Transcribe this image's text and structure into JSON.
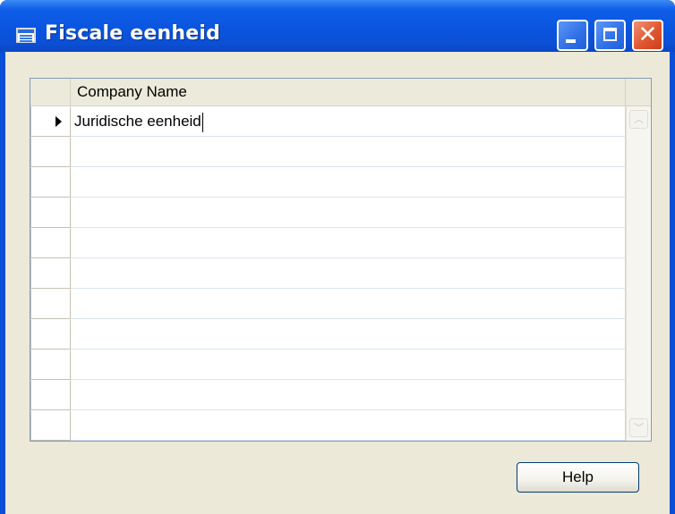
{
  "window": {
    "title": "Fiscale eenheid",
    "title_icon": "form-icon",
    "buttons": {
      "minimize_icon": "minimize-icon",
      "maximize_icon": "maximize-icon",
      "close_icon": "close-icon"
    }
  },
  "grid": {
    "columns": [
      {
        "label": "Company Name"
      }
    ],
    "rows": [
      {
        "company_name": "Juridische eenheid",
        "current": true
      },
      {
        "company_name": ""
      },
      {
        "company_name": ""
      },
      {
        "company_name": ""
      },
      {
        "company_name": ""
      },
      {
        "company_name": ""
      },
      {
        "company_name": ""
      },
      {
        "company_name": ""
      },
      {
        "company_name": ""
      },
      {
        "company_name": ""
      },
      {
        "company_name": ""
      }
    ],
    "lookup_icon": "arrow-up-icon",
    "scroll_up_icon": "scroll-up-icon",
    "scroll_down_icon": "scroll-down-icon"
  },
  "footer": {
    "help_label": "Help"
  },
  "colors": {
    "titlebar": "#0a55df",
    "client_background": "#ece9d8",
    "close_button": "#e0562e"
  }
}
